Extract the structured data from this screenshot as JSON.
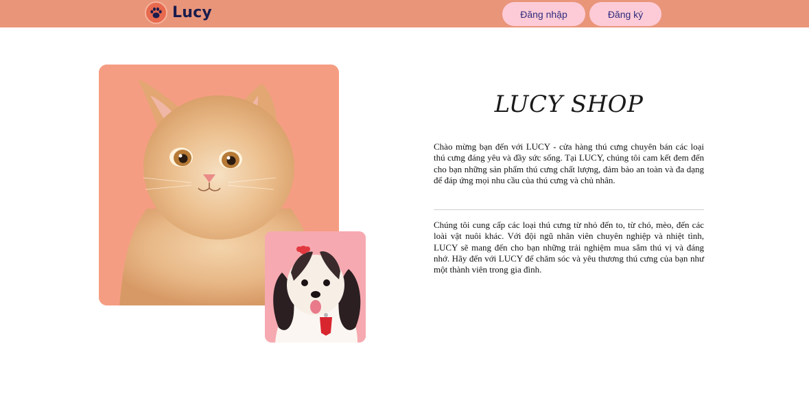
{
  "brand": {
    "name": "Lucy",
    "logo_icon": "paw-icon",
    "accent": "#e76a4f"
  },
  "nav": {
    "background": "#e9957a",
    "login_label": "Đăng nhập",
    "register_label": "Đăng ký",
    "button_color": "#fdcbd7"
  },
  "hero": {
    "title": "LUCY SHOP",
    "main_photo": "orange kitten on salmon background",
    "small_photo": "shih tzu puppy on pink background",
    "paragraphs": [
      "Chào mừng bạn đến với LUCY - cửa hàng thú cưng chuyên bán các loại thú cưng đáng yêu và đầy sức sống. Tại LUCY, chúng tôi cam kết đem đến cho bạn những sản phẩm thú cưng chất lượng, đảm bảo an toàn và đa dạng để đáp ứng mọi nhu cầu của thú cưng và chủ nhân.",
      "Chúng tôi cung cấp các loại thú cưng từ nhỏ đến to, từ chó, mèo, đến các loài vật nuôi khác. Với đội ngũ nhân viên chuyên nghiệp và nhiệt tình, LUCY sẽ mang đến cho bạn những trải nghiệm mua sắm thú vị và đáng nhớ. Hãy đến với LUCY để chăm sóc và yêu thương thú cưng của bạn như một thành viên trong gia đình."
    ]
  }
}
